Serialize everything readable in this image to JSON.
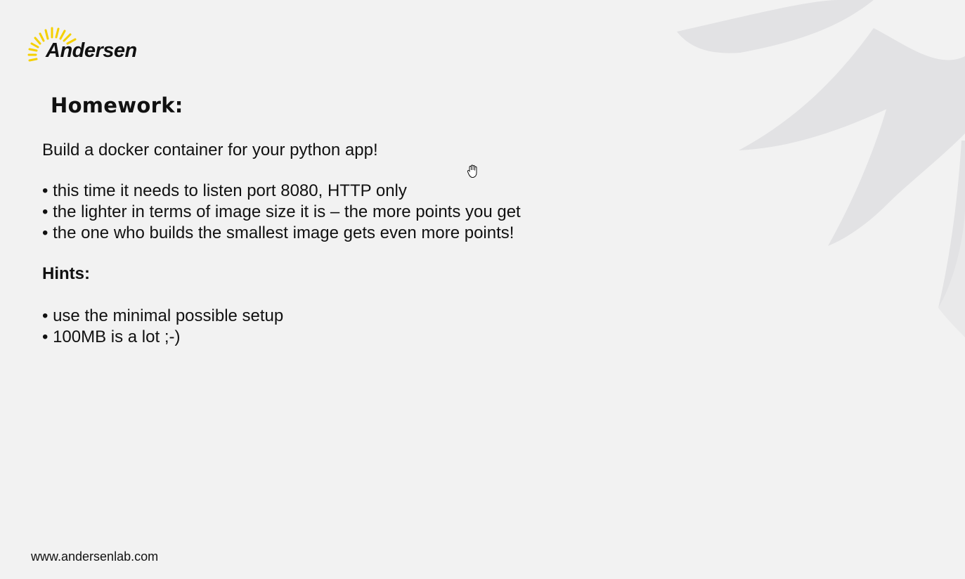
{
  "brand": {
    "name": "Andersen",
    "sun_color": "#f5d000"
  },
  "slide": {
    "title": "Homework:",
    "intro": "Build a docker container for your python app!",
    "requirements": [
      "this time it needs to listen port 8080, HTTP only",
      "the lighter in terms of image size it is – the more points you get",
      "the one who builds the smallest image gets even more points!"
    ],
    "hints_title": "Hints:",
    "hints": [
      "use the minimal possible setup",
      "100MB is a lot ;-)"
    ]
  },
  "footer": {
    "url": "www.andersenlab.com"
  },
  "icons": {
    "logo": "sun-icon",
    "background": "sun-rays-decoration",
    "cursor": "hand-cursor-icon"
  },
  "colors": {
    "background": "#f2f2f2",
    "decoration": "#e2e2e4",
    "text": "#111111"
  }
}
